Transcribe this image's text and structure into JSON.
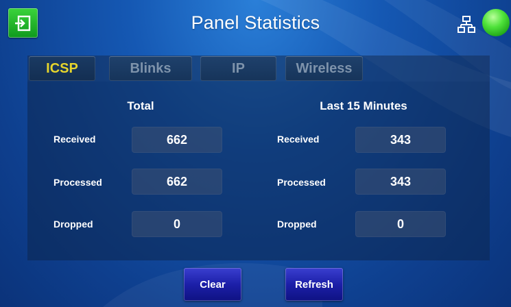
{
  "header": {
    "title": "Panel Statistics"
  },
  "tabs": [
    {
      "label": "ICSP",
      "active": true
    },
    {
      "label": "Blinks",
      "active": false
    },
    {
      "label": "IP",
      "active": false
    },
    {
      "label": "Wireless",
      "active": false
    }
  ],
  "total": {
    "heading": "Total",
    "rows": [
      {
        "label": "Received",
        "value": "662"
      },
      {
        "label": "Processed",
        "value": "662"
      },
      {
        "label": "Dropped",
        "value": "0"
      }
    ]
  },
  "last15": {
    "heading": "Last 15 Minutes",
    "rows": [
      {
        "label": "Received",
        "value": "343"
      },
      {
        "label": "Processed",
        "value": "343"
      },
      {
        "label": "Dropped",
        "value": "0"
      }
    ]
  },
  "buttons": {
    "clear": "Clear",
    "refresh": "Refresh"
  },
  "icons": {
    "exit": "exit-icon",
    "network": "network-icon",
    "status": "status-online-indicator"
  },
  "colors": {
    "active_tab_text": "#e6d52c",
    "status_green": "#4fe23a",
    "button_blue": "#1c1fa8"
  }
}
